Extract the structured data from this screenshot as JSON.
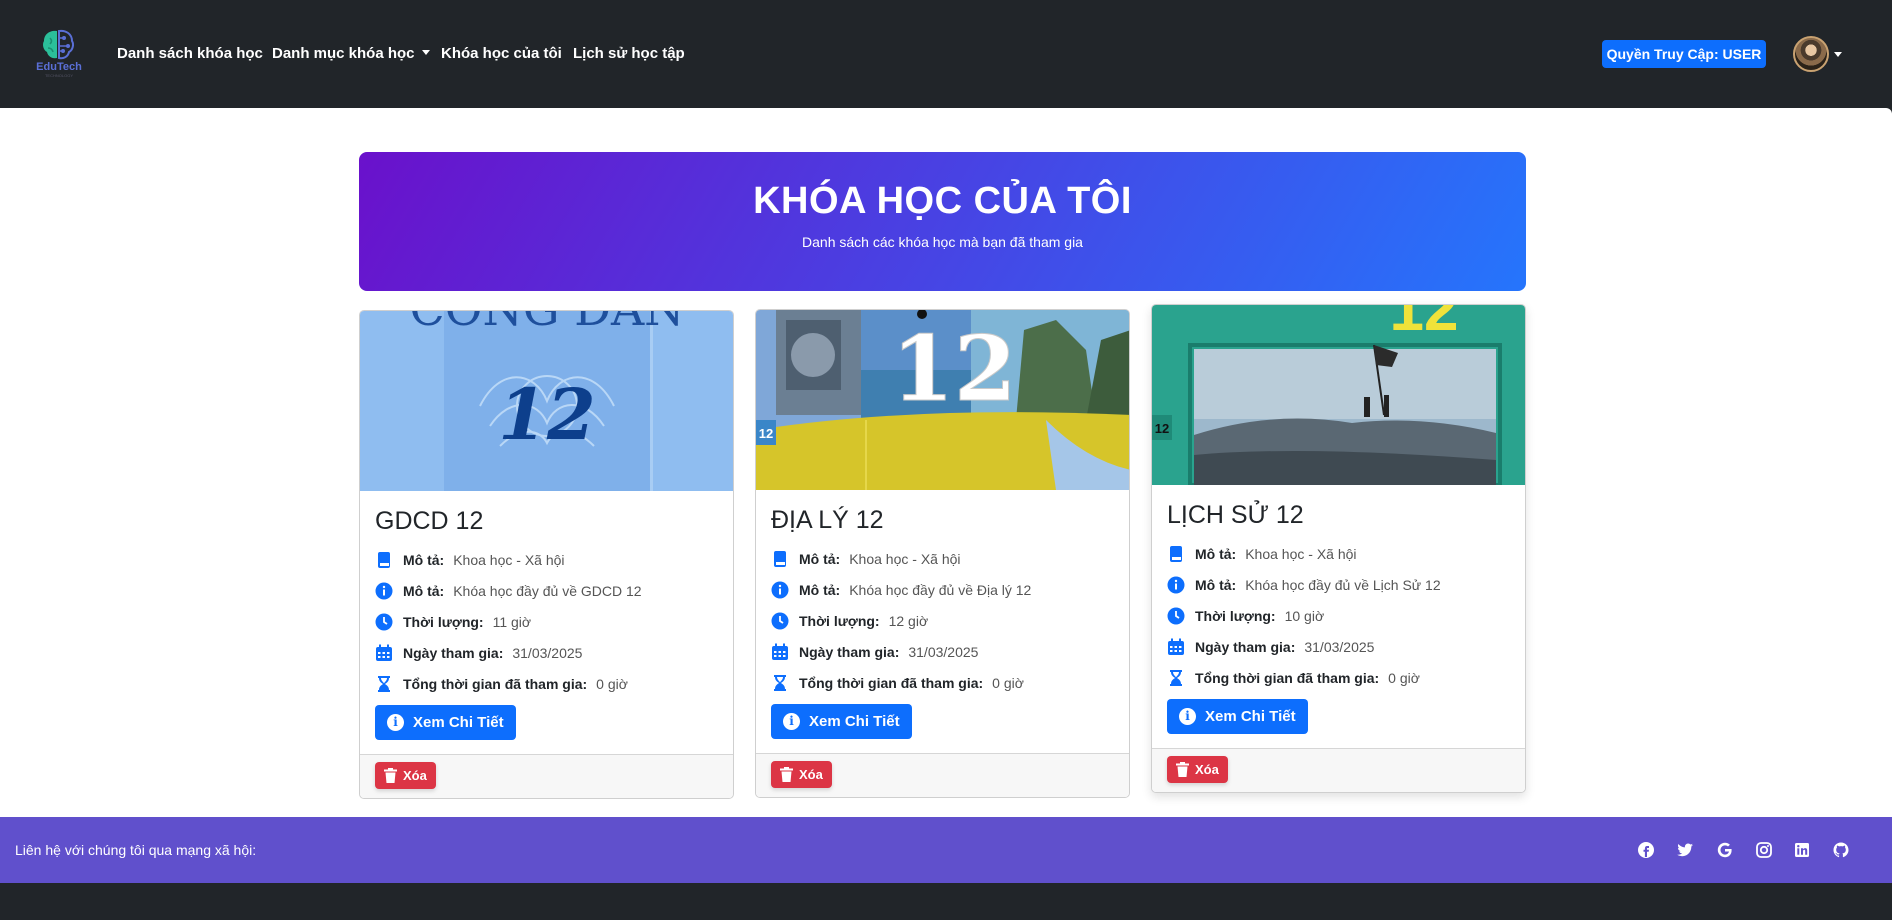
{
  "brand": {
    "name": "EduTech",
    "tagline": "TECHNOLOGY"
  },
  "nav": {
    "links": [
      "Danh sách khóa học",
      "Danh mục khóa học",
      "Khóa học của tôi",
      "Lịch sử học tập"
    ],
    "role_badge": "Quyền Truy Cập: USER"
  },
  "hero": {
    "title": "KHÓA HỌC CỦA TÔI",
    "subtitle": "Danh sách các khóa học mà bạn đã tham gia"
  },
  "labels": {
    "description": "Mô tả:",
    "duration": "Thời lượng:",
    "join_date": "Ngày tham gia:",
    "total_time": "Tổng thời gian đã tham gia:",
    "detail_button": "Xem Chi Tiết",
    "delete_button": "Xóa"
  },
  "courses": [
    {
      "title": "GDCD 12",
      "category": "Khoa học - Xã hội",
      "description": "Khóa học đầy đủ về GDCD 12",
      "duration": "11 giờ",
      "join_date": "31/03/2025",
      "total_time": "0 giờ",
      "cover_text": "CÔNG DÂN",
      "cover_number": "12"
    },
    {
      "title": "ĐỊA LÝ 12",
      "category": "Khoa học - Xã hội",
      "description": "Khóa học đầy đủ về Địa lý 12",
      "duration": "12 giờ",
      "join_date": "31/03/2025",
      "total_time": "0 giờ",
      "cover_number": "12"
    },
    {
      "title": "LỊCH SỬ 12",
      "category": "Khoa học - Xã hội",
      "description": "Khóa học đầy đủ về Lịch Sử 12",
      "duration": "10 giờ",
      "join_date": "31/03/2025",
      "total_time": "0 giờ",
      "cover_number": "12"
    }
  ],
  "footer": {
    "contact_text": "Liên hệ với chúng tôi qua mạng xã hội:",
    "social_icons": [
      "facebook-icon",
      "twitter-icon",
      "google-icon",
      "instagram-icon",
      "linkedin-icon",
      "github-icon"
    ]
  },
  "colors": {
    "primary": "#0d6efd",
    "danger": "#dc3545",
    "navbar": "#212529",
    "footer": "#6050cc",
    "hero_start": "#6a11cb",
    "hero_end": "#2575fc"
  }
}
